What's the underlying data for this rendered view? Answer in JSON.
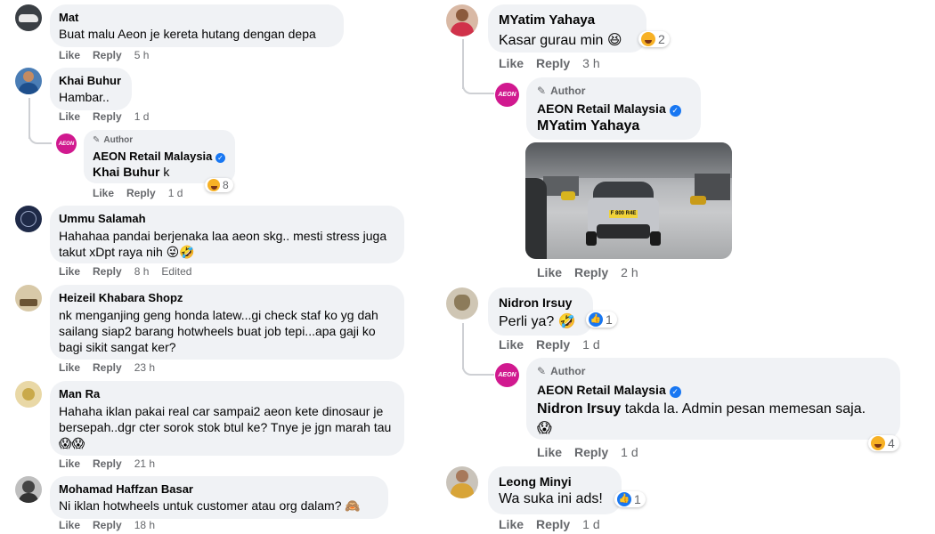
{
  "left": {
    "comments": [
      {
        "name": "Mat",
        "text": "Buat malu Aeon je kereta hutang dengan depa",
        "like": "Like",
        "reply": "Reply",
        "time": "5 h"
      },
      {
        "name": "Khai Buhur",
        "text": "Hambar..",
        "like": "Like",
        "reply": "Reply",
        "time": "1 d"
      },
      {
        "author_label": "Author",
        "name": "AEON Retail Malaysia",
        "mention": "Khai Buhur",
        "text": "k",
        "like": "Like",
        "reply": "Reply",
        "time": "1 d",
        "reaction_count": "8",
        "logo_text": "AEON"
      },
      {
        "name": "Ummu Salamah",
        "text": "Hahahaa pandai berjenaka laa aeon skg.. mesti stress juga takut xDpt raya nih 😜🤣",
        "like": "Like",
        "reply": "Reply",
        "time": "8 h",
        "edited": "Edited"
      },
      {
        "name": "Heizeil Khabara Shopz",
        "text": "nk menganjing geng honda latew...gi check staf ko yg dah sailang siap2 barang hotwheels buat job tepi...apa gaji ko bagi sikit sangat ker?",
        "like": "Like",
        "reply": "Reply",
        "time": "23 h"
      },
      {
        "name": "Man Ra",
        "text": "Hahaha iklan pakai real car sampai2 aeon kete dinosaur je bersepah..dgr cter sorok stok btul ke? Tnye je jgn marah tau 😱😱",
        "like": "Like",
        "reply": "Reply",
        "time": "21 h"
      },
      {
        "name": "Mohamad Haffzan Basar",
        "text": "Ni iklan hotwheels untuk customer atau org dalam? 🙈",
        "like": "Like",
        "reply": "Reply",
        "time": "18 h"
      }
    ]
  },
  "right": {
    "comments": [
      {
        "name": "MYatim Yahaya",
        "text": "Kasar gurau min 😆",
        "reaction_count": "2",
        "like": "Like",
        "reply": "Reply",
        "time": "3 h"
      },
      {
        "author_label": "Author",
        "name": "AEON Retail Malaysia",
        "mention": "MYatim Yahaya",
        "like": "Like",
        "reply": "Reply",
        "time": "2 h",
        "logo_text": "AEON",
        "plate": "F 800 R4E"
      },
      {
        "name": "Nidron Irsuy",
        "text": "Perli ya? 🤣",
        "reaction_count": "1",
        "like": "Like",
        "reply": "Reply",
        "time": "1 d"
      },
      {
        "author_label": "Author",
        "name": "AEON Retail Malaysia",
        "mention": "Nidron Irsuy",
        "text": "takda la. Admin pesan memesan saja. 😱",
        "reaction_count": "4",
        "like": "Like",
        "reply": "Reply",
        "time": "1 d",
        "logo_text": "AEON"
      },
      {
        "name": "Leong Minyi",
        "text": "Wa suka ini ads!",
        "reaction_count": "1",
        "like": "Like",
        "reply": "Reply",
        "time": "1 d"
      }
    ]
  },
  "colors": {
    "bubble": "#f0f2f5",
    "meta": "#65676b",
    "link_blue": "#1877f2",
    "aeon_pink": "#d1198f",
    "haha_yellow": "#f7b125"
  }
}
